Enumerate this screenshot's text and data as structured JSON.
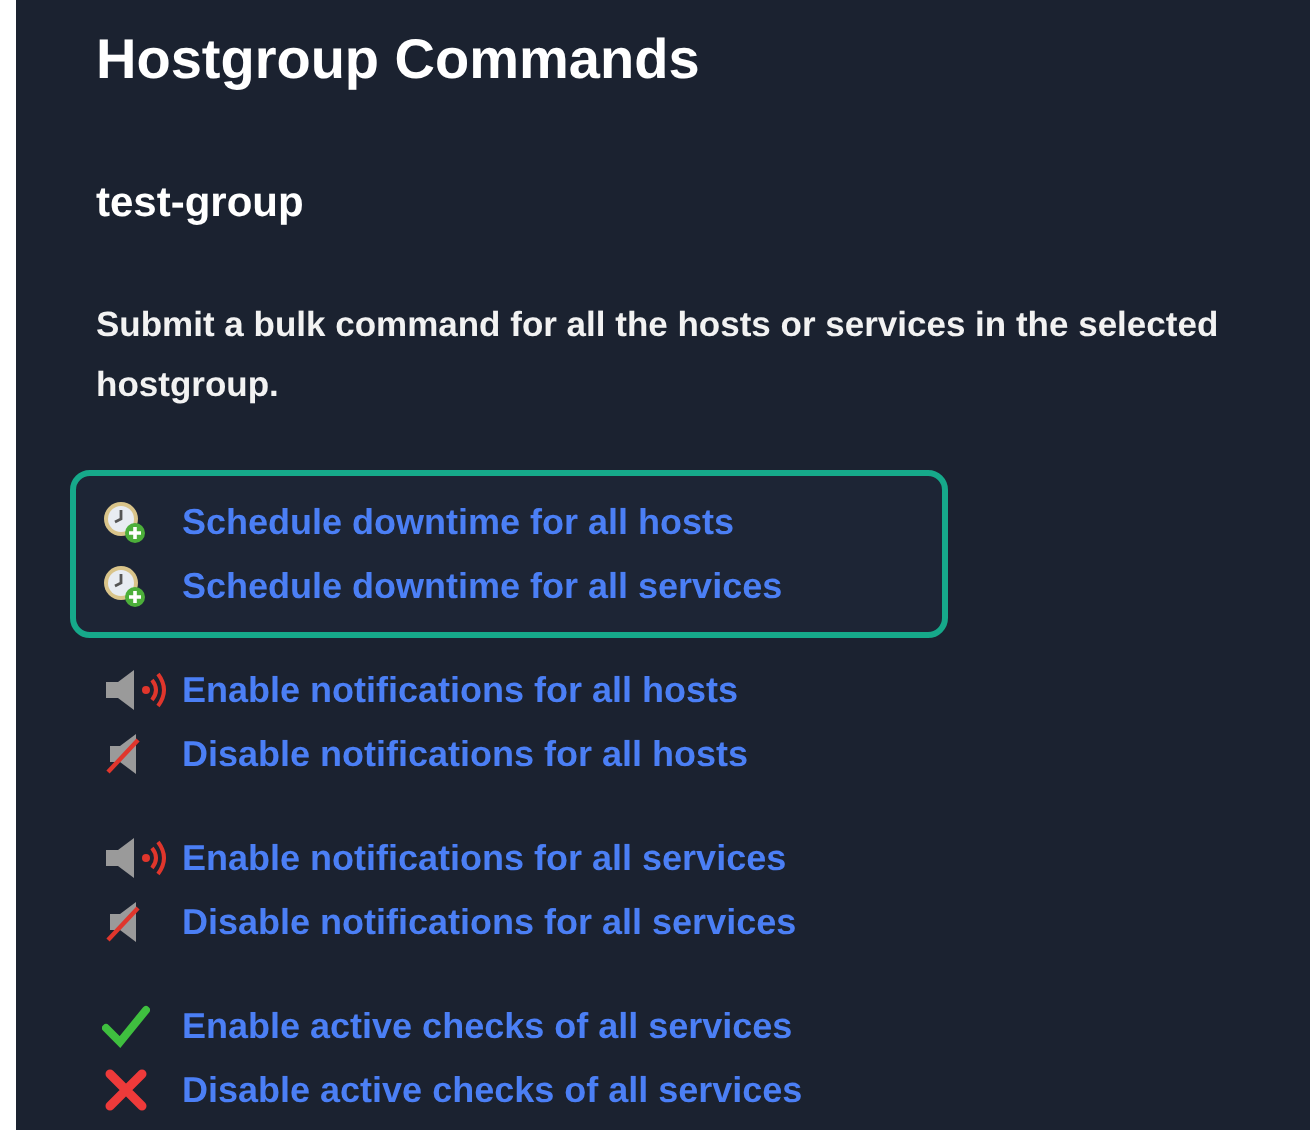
{
  "title": "Hostgroup Commands",
  "hostgroup": "test-group",
  "description": "Submit a bulk command for all the hosts or services in the selected hostgroup.",
  "command_groups": [
    {
      "highlighted": true,
      "commands": [
        {
          "kind": "downtime",
          "label": "Schedule downtime for all hosts"
        },
        {
          "kind": "downtime",
          "label": "Schedule downtime for all services"
        }
      ]
    },
    {
      "highlighted": false,
      "commands": [
        {
          "kind": "notify-on",
          "label": "Enable notifications for all hosts"
        },
        {
          "kind": "notify-off",
          "label": "Disable notifications for all hosts"
        }
      ]
    },
    {
      "highlighted": false,
      "commands": [
        {
          "kind": "notify-on",
          "label": "Enable notifications for all services"
        },
        {
          "kind": "notify-off",
          "label": "Disable notifications for all services"
        }
      ]
    },
    {
      "highlighted": false,
      "commands": [
        {
          "kind": "check-on",
          "label": "Enable active checks of all services"
        },
        {
          "kind": "check-off",
          "label": "Disable active checks of all services"
        }
      ]
    }
  ]
}
